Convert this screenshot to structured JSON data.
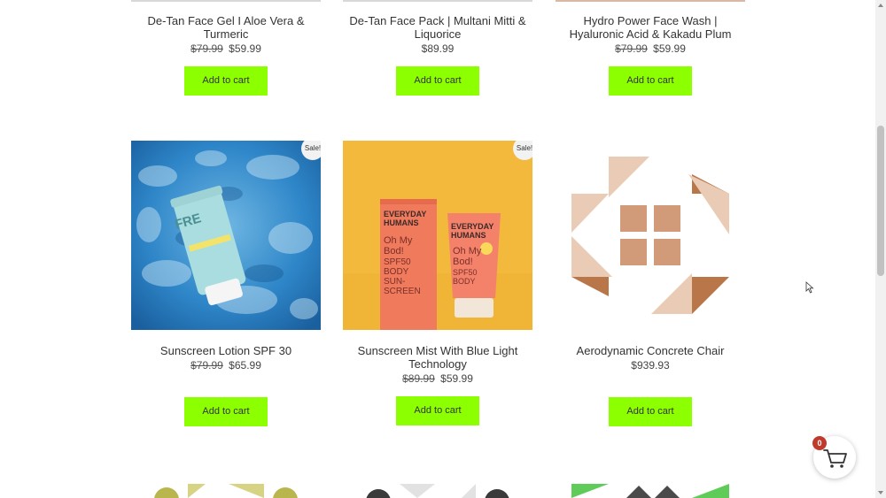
{
  "top_row": [
    {
      "title": "De-Tan Face Gel I Aloe Vera & Turmeric",
      "old_price": "$79.99",
      "price": "$59.99",
      "button": "Add to cart"
    },
    {
      "title": "De-Tan Face Pack | Multani Mitti & Liquorice",
      "old_price": "",
      "price": "$89.99",
      "button": "Add to cart"
    },
    {
      "title": "Hydro Power Face Wash | Hyaluronic Acid & Kakadu Plum",
      "old_price": "$79.99",
      "price": "$59.99",
      "button": "Add to cart"
    }
  ],
  "middle_row": [
    {
      "title": "Sunscreen Lotion SPF 30",
      "old_price": "$79.99",
      "price": "$65.99",
      "button": "Add to cart",
      "badge": "Sale!",
      "tube_text": "FRE"
    },
    {
      "title": "Sunscreen Mist With Blue Light Technology",
      "old_price": "$89.99",
      "price": "$59.99",
      "button": "Add to cart",
      "badge": "Sale!",
      "box_text": [
        "EVERYDAY",
        "HUMANS",
        "Oh My",
        "Bod!",
        "SPF50",
        "BODY",
        "SUN-",
        "SCREEN"
      ]
    },
    {
      "title": "Aerodynamic Concrete Chair",
      "old_price": "",
      "price": "$939.93",
      "button": "Add to cart"
    }
  ],
  "cart": {
    "count": "0"
  },
  "colors": {
    "button": "#8cff00",
    "cart_badge": "#c0392b"
  }
}
